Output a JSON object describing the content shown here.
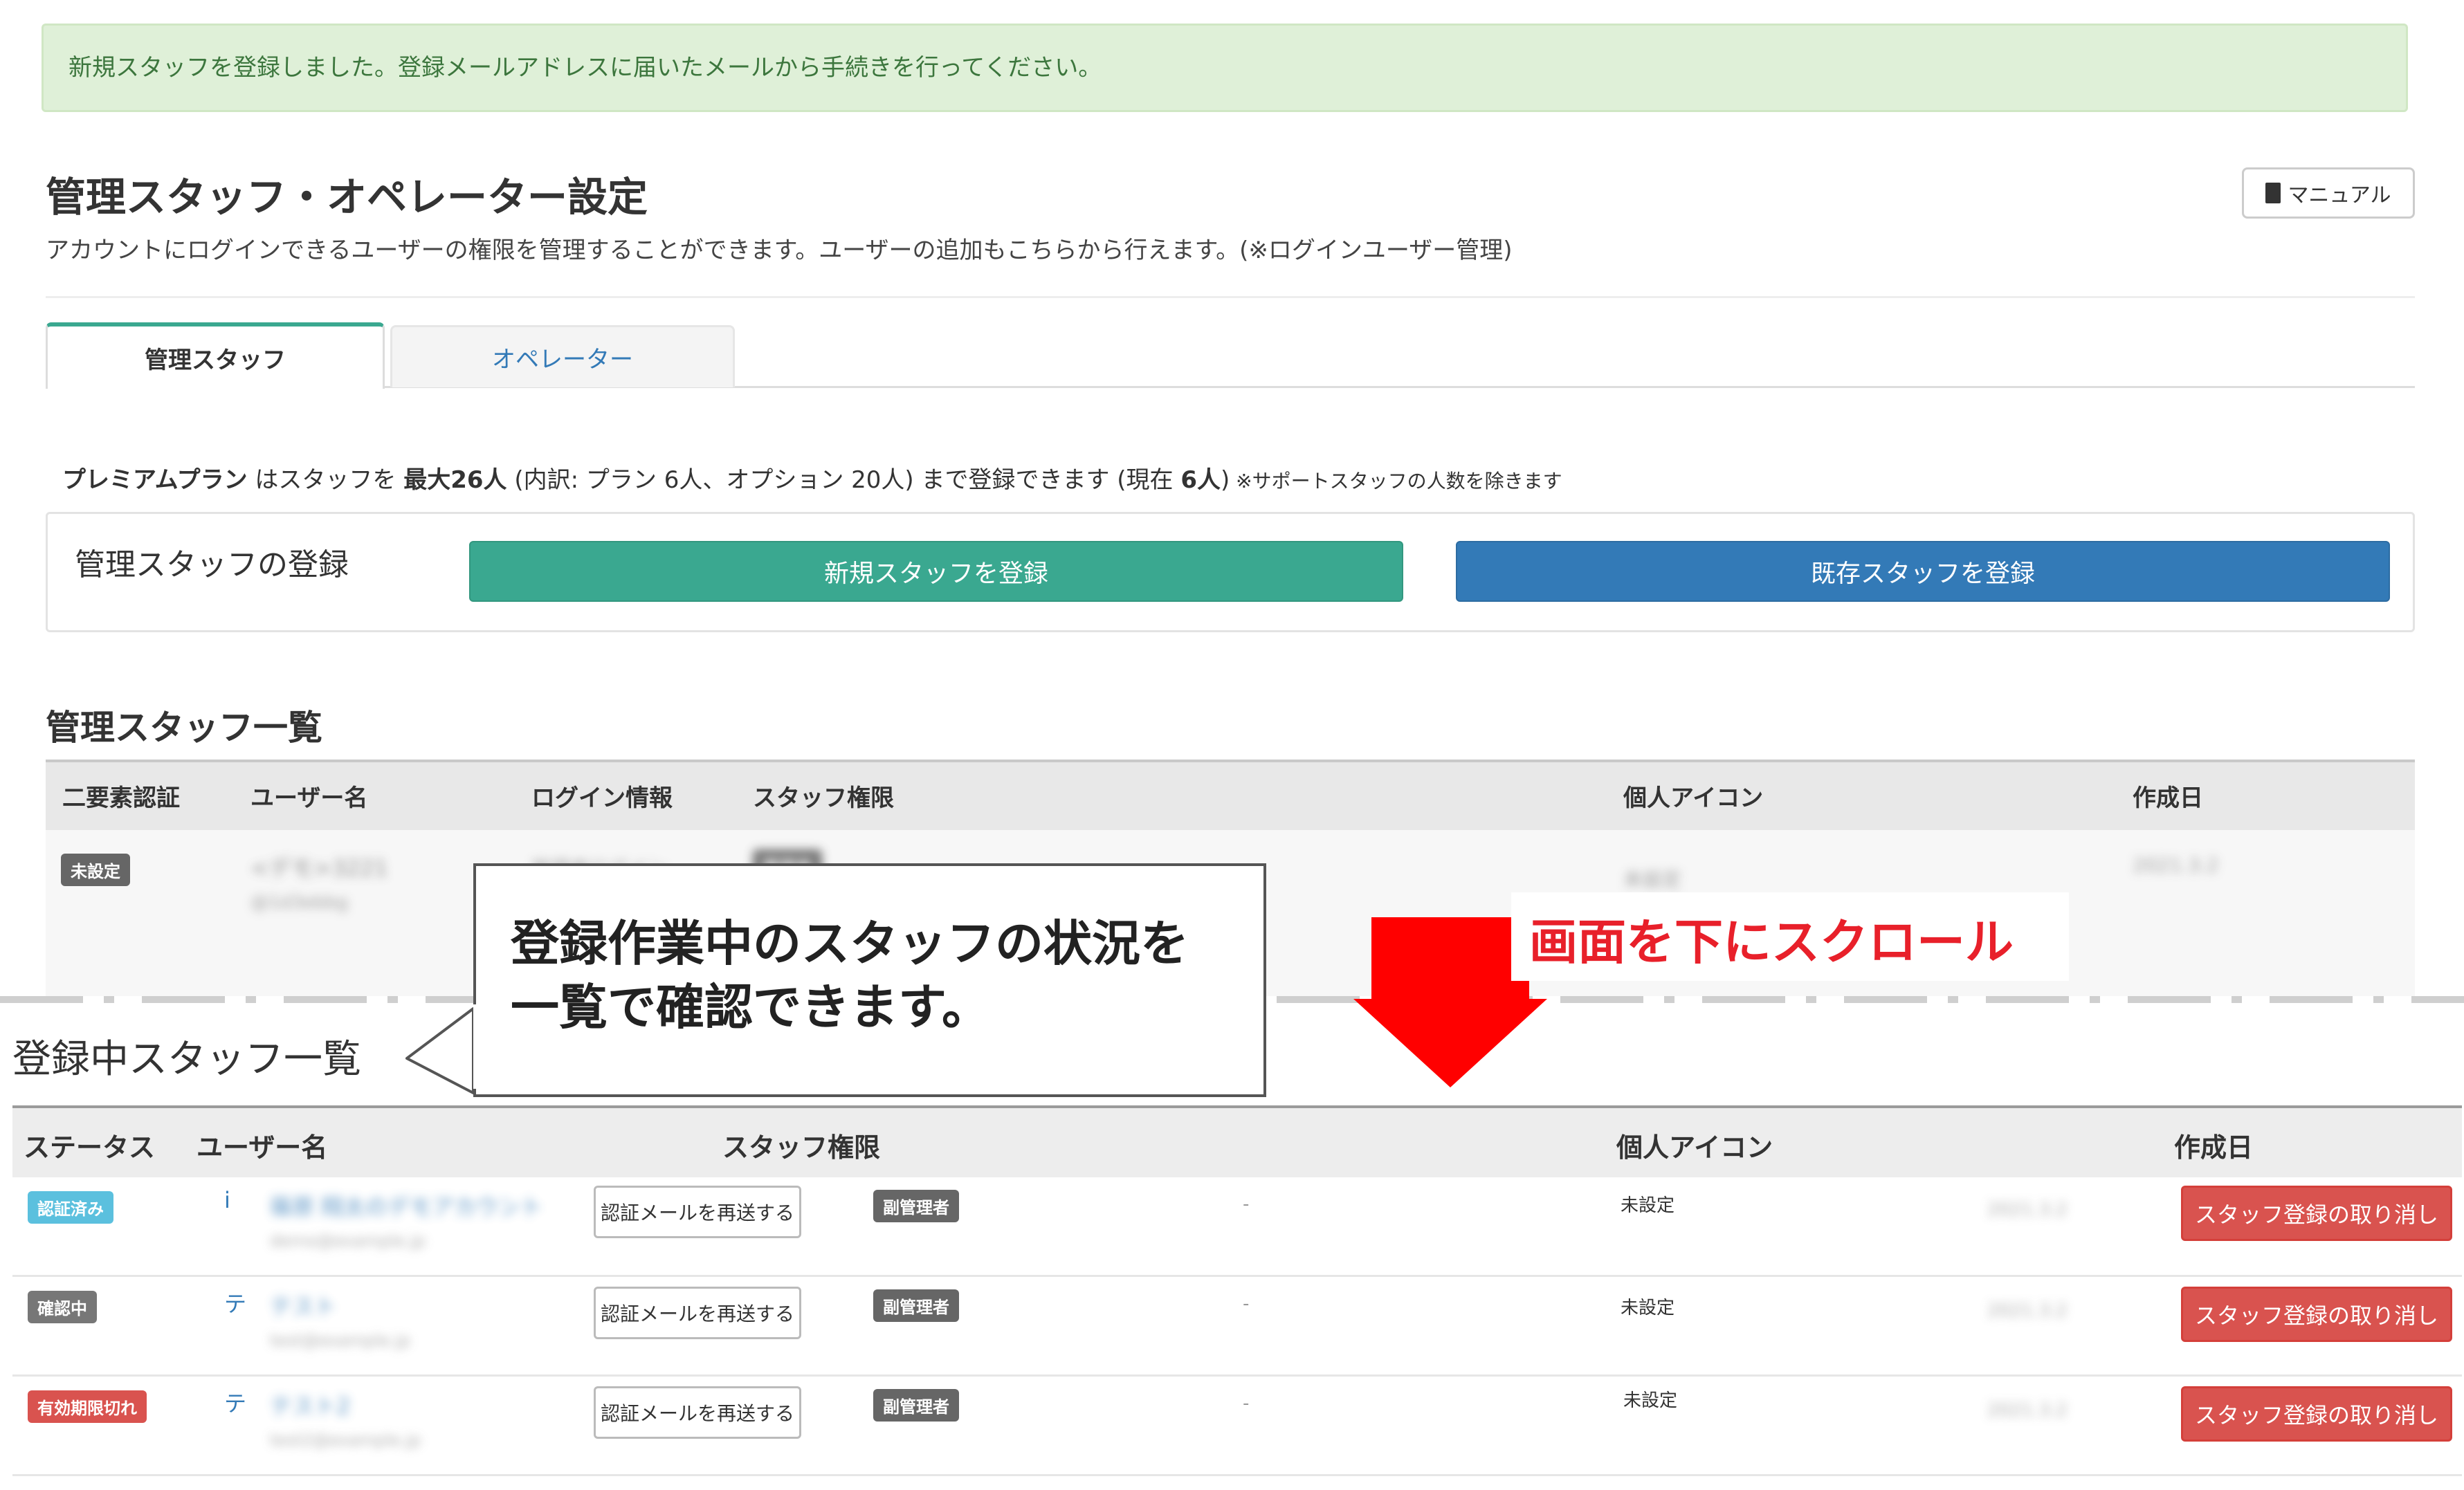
{
  "alert": {
    "message": "新規スタッフを登録しました。登録メールアドレスに届いたメールから手続きを行ってください。"
  },
  "header": {
    "title": "管理スタッフ・オペレーター設定",
    "description": "アカウントにログインできるユーザーの権限を管理することができます。ユーザーの追加もこちらから行えます。(※ログインユーザー管理)",
    "manual_label": "マニュアル"
  },
  "tabs": [
    {
      "label": "管理スタッフ",
      "active": true
    },
    {
      "label": "オペレーター",
      "active": false
    }
  ],
  "plan": {
    "plan_name": "プレミアムプラン",
    "text1": " はスタッフを ",
    "max": "最大26人",
    "text2": " (内訳: プラン 6人、オプション 20人) まで登録できます (現在 ",
    "current": "6人",
    "text3": ")",
    "note": " ※サポートスタッフの人数を除きます"
  },
  "register": {
    "label": "管理スタッフの登録",
    "new_button": "新規スタッフを登録",
    "existing_button": "既存スタッフを登録"
  },
  "staff_list": {
    "title": "管理スタッフ一覧",
    "columns": [
      "二要素認証",
      "ユーザー名",
      "ログイン情報",
      "スタッフ権限",
      "個人アイコン",
      "作成日"
    ],
    "row": {
      "twofa": "未設定",
      "username": "<デモ>3221",
      "username_sub": "@1d3ebbg",
      "login": "管理者ログイン",
      "role": "管理者",
      "icon": "未設定",
      "created": "2021.3.2"
    }
  },
  "pending_list": {
    "title": "登録中スタッフ一覧",
    "columns": [
      "ステータス",
      "ユーザー名",
      "スタッフ権限",
      "個人アイコン",
      "作成日"
    ],
    "rows": [
      {
        "status": "認証済み",
        "status_color": "#5bc0de",
        "prefix": "i",
        "name": "篠原 翔太のデモアカウント",
        "email": "demo@example.jp",
        "resend": "認証メールを再送する",
        "role": "副管理者",
        "dash": "-",
        "icon": "未設定",
        "created": "2021.3.2",
        "cancel": "スタッフ登録の取り消し"
      },
      {
        "status": "確認中",
        "status_color": "#777777",
        "prefix": "テ",
        "name": "テスト",
        "email": "test@example.jp",
        "resend": "認証メールを再送する",
        "role": "副管理者",
        "dash": "-",
        "icon": "未設定",
        "created": "2021.3.2",
        "cancel": "スタッフ登録の取り消し"
      },
      {
        "status": "有効期限切れ",
        "status_color": "#d9534f",
        "prefix": "テ",
        "name": "テスト2",
        "email": "test2@example.jp",
        "resend": "認証メールを再送する",
        "role": "副管理者",
        "dash": "-",
        "icon": "未設定",
        "created": "2021.3.2",
        "cancel": "スタッフ登録の取り消し"
      }
    ]
  },
  "annotations": {
    "callout_line1": "登録作業中のスタッフの状況を",
    "callout_line2": "一覧で確認できます。",
    "scroll_text": "画面を下にスクロール",
    "arrow_color": "#ff0000"
  }
}
